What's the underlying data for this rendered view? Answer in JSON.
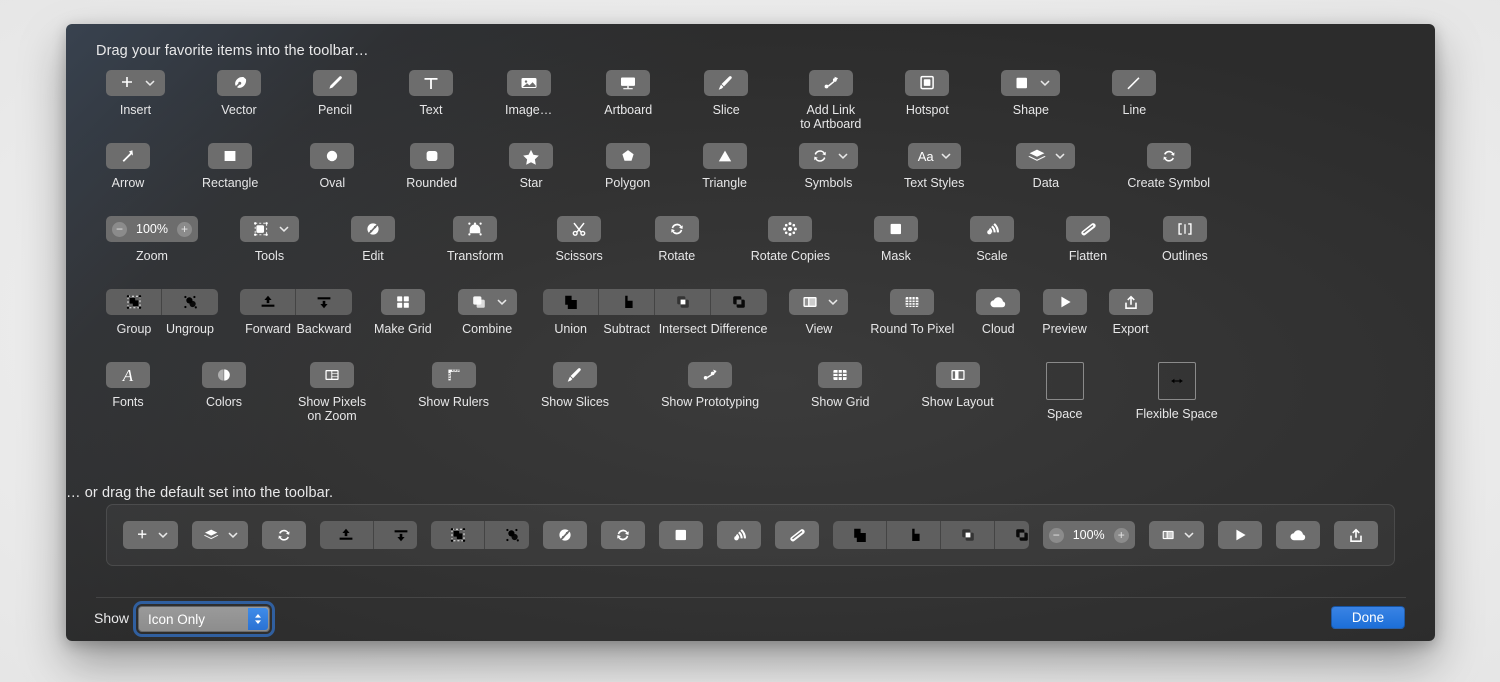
{
  "window": {
    "hint_top": "Drag your favorite items into the toolbar…",
    "hint_bottom": "… or drag the default set into the toolbar."
  },
  "palette": {
    "rows": [
      {
        "items": [
          {
            "label": "Insert",
            "icon": "plus-icon",
            "dropdown": true
          },
          {
            "label": "Vector",
            "icon": "pen-nib-icon"
          },
          {
            "label": "Pencil",
            "icon": "pencil-icon"
          },
          {
            "label": "Text",
            "icon": "text-t-icon"
          },
          {
            "label": "Image…",
            "icon": "image-icon"
          },
          {
            "label": "Artboard",
            "icon": "artboard-icon"
          },
          {
            "label": "Slice",
            "icon": "slice-knife-icon"
          },
          {
            "label": "Add Link\nto Artboard",
            "icon": "link-artboard-icon"
          },
          {
            "label": "Hotspot",
            "icon": "hotspot-icon"
          },
          {
            "label": "Shape",
            "icon": "shape-square-icon",
            "dropdown": true
          },
          {
            "label": "Line",
            "icon": "line-icon"
          }
        ]
      },
      {
        "items": [
          {
            "label": "Arrow",
            "icon": "arrow-icon"
          },
          {
            "label": "Rectangle",
            "icon": "rectangle-icon"
          },
          {
            "label": "Oval",
            "icon": "oval-icon"
          },
          {
            "label": "Rounded",
            "icon": "rounded-rect-icon"
          },
          {
            "label": "Star",
            "icon": "star-icon"
          },
          {
            "label": "Polygon",
            "icon": "polygon-icon"
          },
          {
            "label": "Triangle",
            "icon": "triangle-icon"
          },
          {
            "label": "Symbols",
            "icon": "symbols-icon",
            "dropdown": true
          },
          {
            "label": "Text Styles",
            "icon": "text-styles-aa-icon",
            "dropdown": true
          },
          {
            "label": "Data",
            "icon": "data-layers-icon",
            "dropdown": true
          },
          {
            "label": "Create Symbol",
            "icon": "create-symbol-icon"
          }
        ]
      },
      {
        "items": [
          {
            "label": "Zoom",
            "icon": "zoom-stepper",
            "stepper": true,
            "value": "100%",
            "minus": "−",
            "plus": "+"
          },
          {
            "label": "Tools",
            "icon": "tools-icon",
            "dropdown": true
          },
          {
            "label": "Edit",
            "icon": "edit-icon"
          },
          {
            "label": "Transform",
            "icon": "transform-icon"
          },
          {
            "label": "Scissors",
            "icon": "scissors-icon"
          },
          {
            "label": "Rotate",
            "icon": "rotate-icon"
          },
          {
            "label": "Rotate Copies",
            "icon": "rotate-copies-icon"
          },
          {
            "label": "Mask",
            "icon": "mask-icon"
          },
          {
            "label": "Scale",
            "icon": "scale-icon"
          },
          {
            "label": "Flatten",
            "icon": "flatten-icon"
          },
          {
            "label": "Outlines",
            "icon": "outlines-icon"
          }
        ]
      },
      {
        "groups": [
          {
            "type": "segmented",
            "dim": true,
            "labels": [
              "Group",
              "Ungroup"
            ],
            "icons": [
              "group-icon",
              "ungroup-icon"
            ]
          },
          {
            "type": "segmented",
            "dim": true,
            "labels": [
              "Forward",
              "Backward"
            ],
            "icons": [
              "bring-forward-icon",
              "send-backward-icon"
            ]
          },
          {
            "type": "single",
            "label": "Make Grid",
            "icon": "make-grid-icon"
          },
          {
            "type": "single",
            "label": "Combine",
            "icon": "combine-icon",
            "dropdown": true
          },
          {
            "type": "segmented",
            "dim": true,
            "labels": [
              "Union",
              "Subtract",
              "Intersect",
              "Difference"
            ],
            "icons": [
              "union-icon",
              "subtract-icon",
              "intersect-icon",
              "difference-icon"
            ]
          },
          {
            "type": "single",
            "label": "View",
            "icon": "view-icon",
            "dropdown": true
          },
          {
            "type": "single",
            "label": "Round To Pixel",
            "icon": "round-to-pixel-icon"
          },
          {
            "type": "single",
            "label": "Cloud",
            "icon": "cloud-icon"
          },
          {
            "type": "single",
            "label": "Preview",
            "icon": "preview-play-icon"
          },
          {
            "type": "single",
            "label": "Export",
            "icon": "export-icon"
          }
        ]
      },
      {
        "items": [
          {
            "label": "Fonts",
            "icon": "fonts-a-icon"
          },
          {
            "label": "Colors",
            "icon": "colors-icon"
          },
          {
            "label": "Show Pixels\non Zoom",
            "icon": "show-pixels-icon"
          },
          {
            "label": "Show Rulers",
            "icon": "show-rulers-icon"
          },
          {
            "label": "Show Slices",
            "icon": "show-slices-icon"
          },
          {
            "label": "Show Prototyping",
            "icon": "show-prototyping-icon"
          },
          {
            "label": "Show Grid",
            "icon": "show-grid-icon"
          },
          {
            "label": "Show Layout",
            "icon": "show-layout-icon"
          },
          {
            "label": "Space",
            "icon": "space-box-icon",
            "outline": true
          },
          {
            "label": "Flexible Space",
            "icon": "flexible-space-icon",
            "outline": true
          }
        ]
      }
    ]
  },
  "default_toolbar": {
    "items": [
      {
        "icon": "plus-icon",
        "name": "insert",
        "dropdown": true
      },
      {
        "icon": "data-layers-icon",
        "name": "data",
        "dropdown": true
      },
      {
        "icon": "create-symbol-icon",
        "name": "create-symbol"
      },
      {
        "type": "segmented",
        "dim": true,
        "icons": [
          "bring-forward-icon",
          "send-backward-icon"
        ],
        "names": [
          "forward",
          "backward"
        ]
      },
      {
        "type": "segmented",
        "dim": true,
        "icons": [
          "group-icon",
          "ungroup-icon"
        ],
        "names": [
          "group",
          "ungroup"
        ]
      },
      {
        "icon": "edit-icon",
        "name": "edit"
      },
      {
        "icon": "rotate-icon",
        "name": "rotate"
      },
      {
        "icon": "mask-icon",
        "name": "mask"
      },
      {
        "icon": "scale-icon",
        "name": "scale"
      },
      {
        "icon": "flatten-icon",
        "name": "flatten"
      },
      {
        "type": "segmented",
        "dim": true,
        "icons": [
          "union-icon",
          "subtract-icon",
          "intersect-icon",
          "difference-icon"
        ],
        "names": [
          "union",
          "subtract",
          "intersect",
          "difference"
        ]
      },
      {
        "type": "stepper",
        "name": "zoom",
        "value": "100%",
        "minus": "−",
        "plus": "+"
      },
      {
        "icon": "view-icon",
        "name": "view",
        "dropdown": true
      },
      {
        "icon": "preview-play-icon",
        "name": "preview"
      },
      {
        "icon": "cloud-icon",
        "name": "cloud"
      },
      {
        "icon": "export-icon",
        "name": "export"
      }
    ]
  },
  "bottom_bar": {
    "show_label": "Show",
    "show_value": "Icon Only",
    "show_options": [
      "Icon Only"
    ],
    "done_label": "Done"
  },
  "colors": {
    "accent_blue": "#2b72d4",
    "done_blue": "#1c6fd8",
    "chip_gray": "#6d6d6d",
    "window_bg": "#343434",
    "text": "#e7e7e8"
  }
}
